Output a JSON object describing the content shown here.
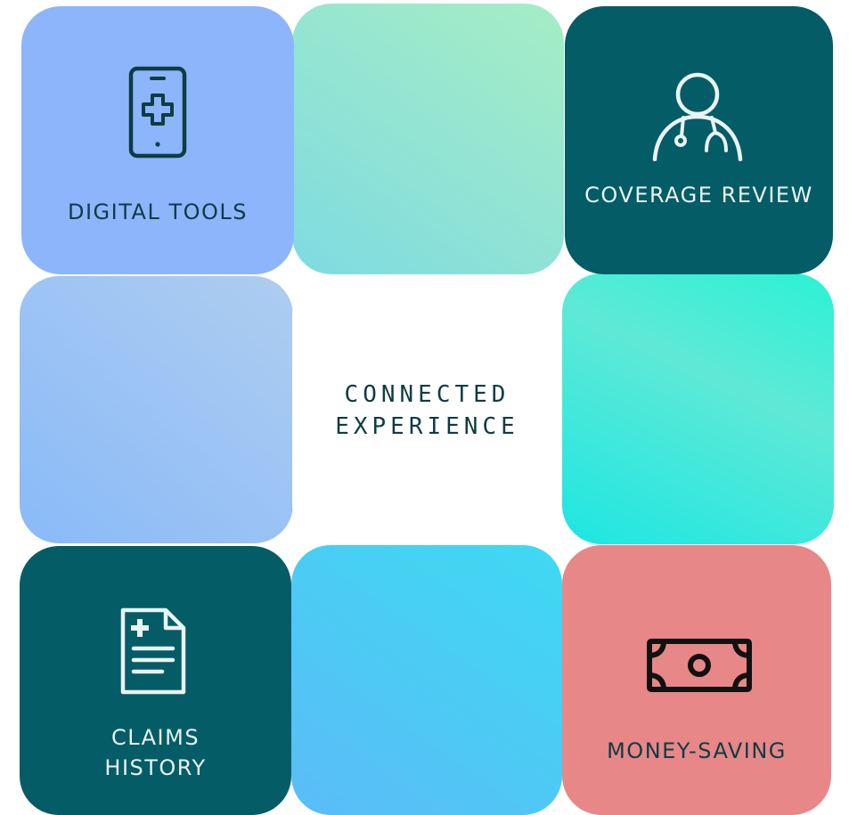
{
  "center": {
    "line1": "CONNECTED",
    "line2": "EXPERIENCE"
  },
  "tiles": {
    "digital_tools": {
      "label": "DIGITAL TOOLS",
      "icon": "mobile-medical-icon",
      "color": "#8db5fc"
    },
    "coverage_review": {
      "label": "COVERAGE REVIEW",
      "icon": "doctor-icon",
      "color": "#045c66"
    },
    "claims_history": {
      "label_line1": "CLAIMS",
      "label_line2": "HISTORY",
      "icon": "medical-document-icon",
      "color": "#045c66"
    },
    "money_saving": {
      "label": "MONEY-SAVING",
      "icon": "banknote-icon",
      "color": "#e78787"
    }
  }
}
